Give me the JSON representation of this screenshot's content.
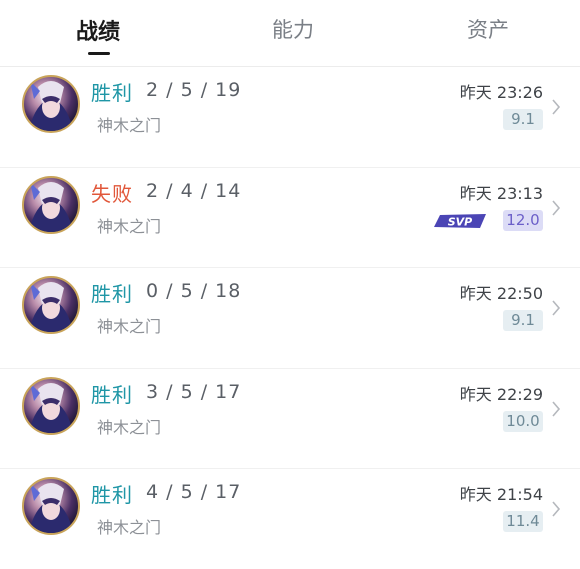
{
  "tabs": [
    {
      "label": "战绩",
      "active": true
    },
    {
      "label": "能力",
      "active": false
    },
    {
      "label": "资产",
      "active": false
    }
  ],
  "colors": {
    "win": "#1f96a6",
    "lose": "#e1573a",
    "svp": "#6b5fc9"
  },
  "matches": [
    {
      "result": "胜利",
      "outcome": "win",
      "kda": "2 / 5 / 19",
      "map": "神木之门",
      "time": "昨天 23:26",
      "score": "9.1",
      "badge": ""
    },
    {
      "result": "失败",
      "outcome": "lose",
      "kda": "2 / 4 / 14",
      "map": "神木之门",
      "time": "昨天 23:13",
      "score": "12.0",
      "badge": "SVP"
    },
    {
      "result": "胜利",
      "outcome": "win",
      "kda": "0 / 5 / 18",
      "map": "神木之门",
      "time": "昨天 22:50",
      "score": "9.1",
      "badge": ""
    },
    {
      "result": "胜利",
      "outcome": "win",
      "kda": "3 / 5 / 17",
      "map": "神木之门",
      "time": "昨天 22:29",
      "score": "10.0",
      "badge": ""
    },
    {
      "result": "胜利",
      "outcome": "win",
      "kda": "4 / 5 / 17",
      "map": "神木之门",
      "time": "昨天 21:54",
      "score": "11.4",
      "badge": ""
    }
  ]
}
